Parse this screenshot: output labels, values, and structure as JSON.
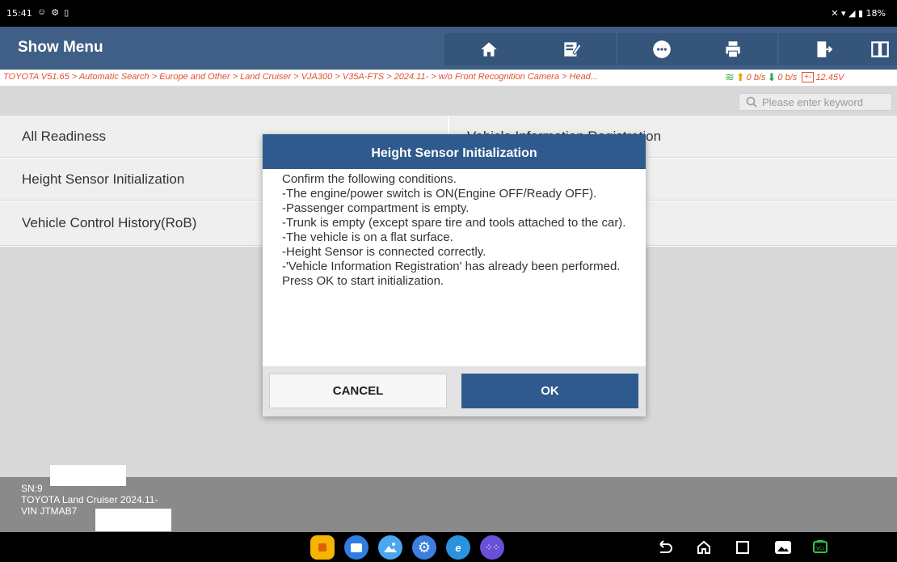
{
  "status_bar": {
    "time": "15:41",
    "right": "18%"
  },
  "header": {
    "title": "Show Menu",
    "buttons": [
      "home-icon",
      "edit-icon",
      "chat-icon",
      "print-icon",
      "exit-icon",
      "split-icon"
    ]
  },
  "breadcrumb": {
    "path": "TOYOTA V51.65 > Automatic Search > Europe and Other > Land Cruiser > VJA300 > V35A-FTS > 2024.11- > w/o Front Recognition Camera > Head...",
    "upload": "0 b/s",
    "download": "0 b/s",
    "voltage": "12.45V"
  },
  "search": {
    "placeholder": "Please enter keyword"
  },
  "menu": {
    "items": [
      "All Readiness",
      "Vehicle Information Registration",
      "Height Sensor Initialization",
      "Vehicle Control History(RoB)"
    ]
  },
  "footer": {
    "sn": "SN:9",
    "vehicle": "TOYOTA Land Cruiser 2024.11-",
    "vin": "VIN JTMAB7"
  },
  "dialog": {
    "title": "Height Sensor Initialization",
    "lines": [
      "Confirm the following conditions.",
      "-The engine/power switch is ON(Engine OFF/Ready OFF).",
      "-Passenger compartment is empty.",
      "-Trunk is empty (except spare tire and tools attached to the car).",
      "-The vehicle is on a flat surface.",
      "-Height Sensor is connected correctly.",
      "-'Vehicle Information Registration' has already been performed.",
      "Press OK to start initialization."
    ],
    "cancel_label": "CANCEL",
    "ok_label": "OK"
  },
  "colors": {
    "header": "#3f5f86",
    "dialog_header": "#2e5a8e",
    "breadcrumb_text": "#e05030"
  }
}
